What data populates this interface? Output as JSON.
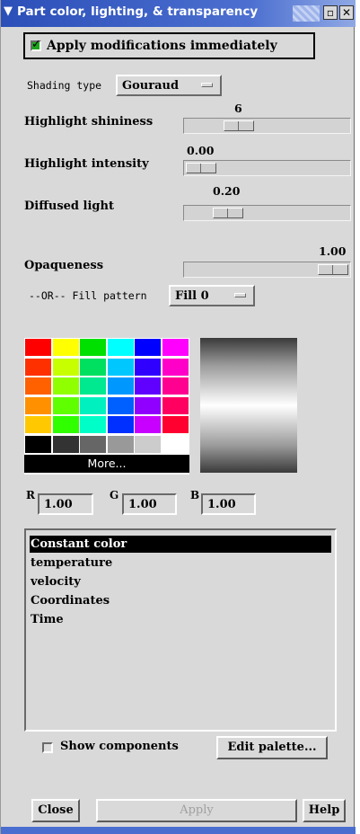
{
  "window": {
    "title": "Part color, lighting, & transparency",
    "menu_glyph": "❯",
    "minimize_glyph": "▫",
    "close_glyph": "✕"
  },
  "apply_immediately": {
    "label": "Apply modifications immediately",
    "checked": true
  },
  "shading": {
    "label": "Shading type",
    "value": "Gouraud"
  },
  "highlight_shininess": {
    "label": "Highlight shininess",
    "value": "6",
    "level": 0.35
  },
  "highlight_intensity": {
    "label": "Highlight intensity",
    "value": "0.00",
    "level": 0.0
  },
  "diffused_light": {
    "label": "Diffused light",
    "value": "0.20",
    "level": 0.2
  },
  "opaqueness": {
    "label": "Opaqueness",
    "value": "1.00",
    "level": 1.0
  },
  "fill_pattern": {
    "label": "--OR-- Fill pattern",
    "value": "Fill 0"
  },
  "palette": {
    "colors": [
      [
        "#ff0000",
        "#ffff00",
        "#00e000",
        "#00ffff",
        "#0000ff",
        "#ff00ff"
      ],
      [
        "#ff3000",
        "#c8ff00",
        "#00e060",
        "#00c8ff",
        "#3000ff",
        "#ff00c8"
      ],
      [
        "#ff6000",
        "#90ff00",
        "#00e890",
        "#0098ff",
        "#6000ff",
        "#ff0090"
      ],
      [
        "#ff9000",
        "#60ff00",
        "#00f0c0",
        "#0060ff",
        "#9000ff",
        "#ff0060"
      ],
      [
        "#ffc800",
        "#30ff00",
        "#00ffc8",
        "#0030ff",
        "#c800ff",
        "#ff0030"
      ],
      [
        "#000000",
        "#333333",
        "#666666",
        "#999999",
        "#cccccc",
        "#ffffff"
      ]
    ],
    "more_label": "More..."
  },
  "rgb": {
    "r_label": "R",
    "r": "1.00",
    "g_label": "G",
    "g": "1.00",
    "b_label": "B",
    "b": "1.00"
  },
  "variables": [
    {
      "label": "Constant color",
      "selected": true
    },
    {
      "label": "temperature",
      "selected": false
    },
    {
      "label": "velocity",
      "selected": false
    },
    {
      "label": "Coordinates",
      "selected": false
    },
    {
      "label": "Time",
      "selected": false
    }
  ],
  "show_components": {
    "label": "Show components",
    "checked": false
  },
  "edit_palette_label": "Edit palette...",
  "buttons": {
    "close": "Close",
    "apply": "Apply",
    "help": "Help"
  }
}
